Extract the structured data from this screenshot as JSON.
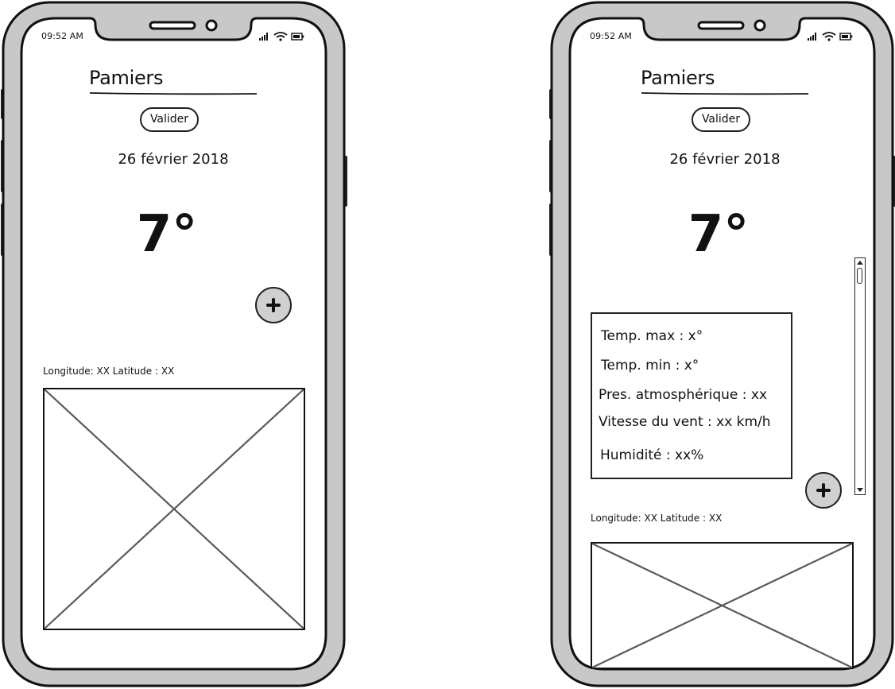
{
  "screens": [
    {
      "status_bar": {
        "time": "09:52 AM"
      },
      "city_name": "Pamiers",
      "validate_label": "Valider",
      "date": "26 février 2018",
      "temperature": "7°",
      "coordinates": "Longitude: XX  Latitude : XX"
    },
    {
      "status_bar": {
        "time": "09:52 AM"
      },
      "city_name": "Pamiers",
      "validate_label": "Valider",
      "date": "26 février 2018",
      "temperature": "7°",
      "details": {
        "temp_max": "Temp. max : x°",
        "temp_min": "Temp. min : x°",
        "pressure": "Pres. atmosphérique : xx",
        "wind_speed": "Vitesse du vent : xx km/h",
        "humidity": "Humidité : xx%"
      },
      "coordinates": "Longitude: XX  Latitude : XX"
    }
  ],
  "colors": {
    "frame": "#c8c8c8",
    "outline": "#111111",
    "button_fill": "#d0d0d0",
    "placeholder_line": "#5a5a5a"
  },
  "icons": [
    "signal-icon",
    "wifi-icon",
    "battery-icon",
    "plus-icon",
    "image-placeholder-icon"
  ]
}
